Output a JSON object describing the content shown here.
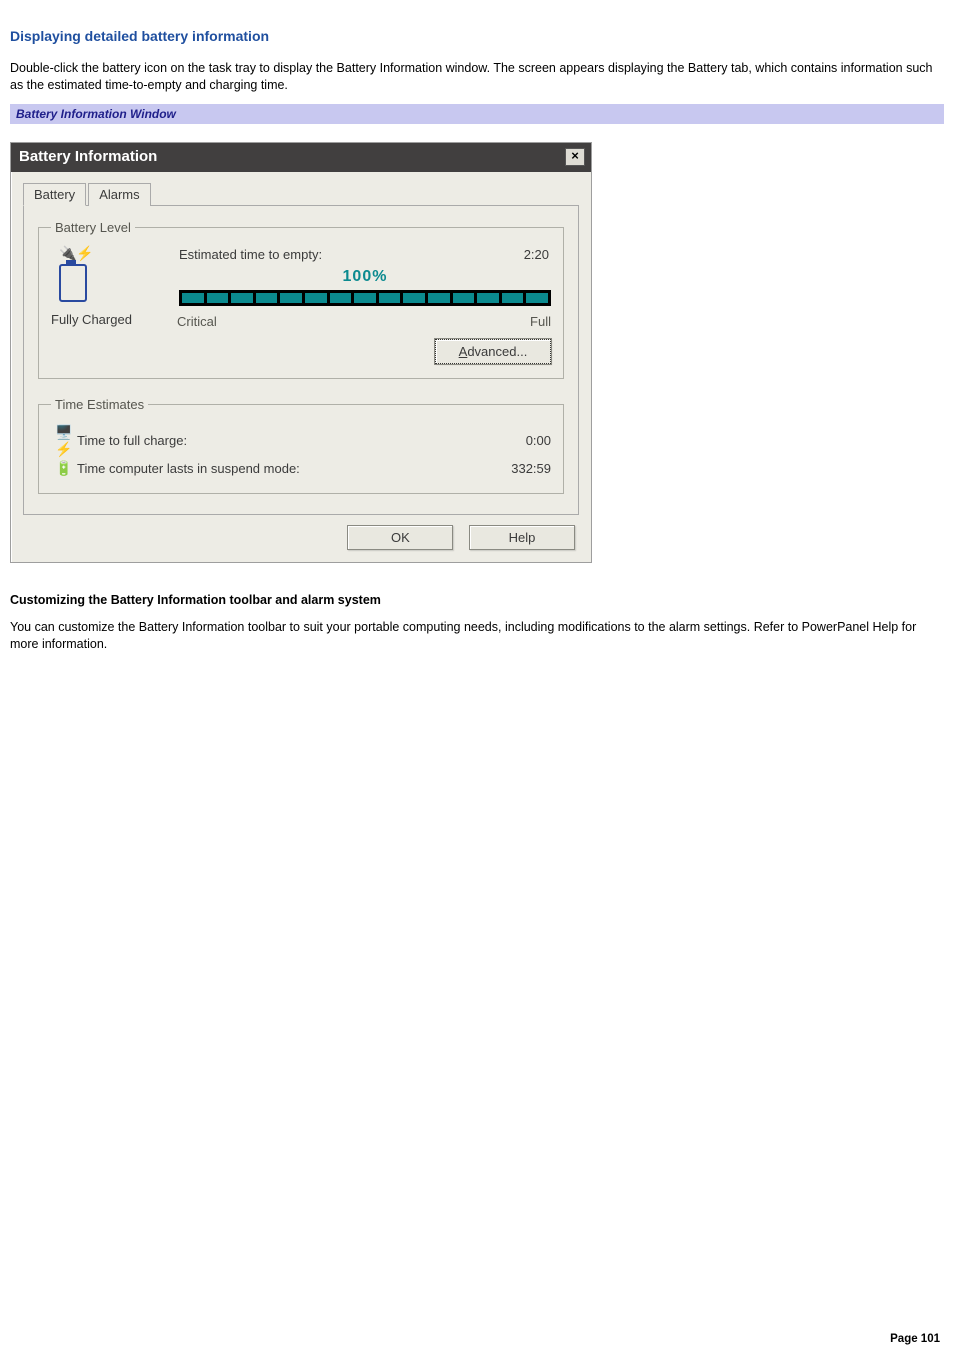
{
  "heading": "Displaying detailed battery information",
  "intro": "Double-click the battery icon on the task tray to display the Battery Information window. The screen appears displaying the Battery tab, which contains information such as the estimated time-to-empty and charging time.",
  "caption": "Battery Information Window",
  "window": {
    "title": "Battery Information",
    "close": "×",
    "tabs": {
      "battery": "Battery",
      "alarms": "Alarms"
    },
    "battery_level": {
      "legend": "Battery Level",
      "est_label": "Estimated time to empty:",
      "est_value": "2:20",
      "percent": "100%",
      "status": "Fully Charged",
      "scale_low": "Critical",
      "scale_high": "Full",
      "advanced_pre": "A",
      "advanced_rest": "dvanced..."
    },
    "time_estimates": {
      "legend": "Time Estimates",
      "full_charge_label": "Time to full charge:",
      "full_charge_value": "0:00",
      "suspend_label": "Time computer lasts in suspend mode:",
      "suspend_value": "332:59"
    },
    "buttons": {
      "ok": "OK",
      "help": "Help"
    }
  },
  "subheading": "Customizing the Battery Information toolbar and alarm system",
  "subtext": "You can customize the Battery Information toolbar to suit your portable computing needs, including modifications to the alarm settings. Refer to PowerPanel Help for more information.",
  "page": "Page 101"
}
